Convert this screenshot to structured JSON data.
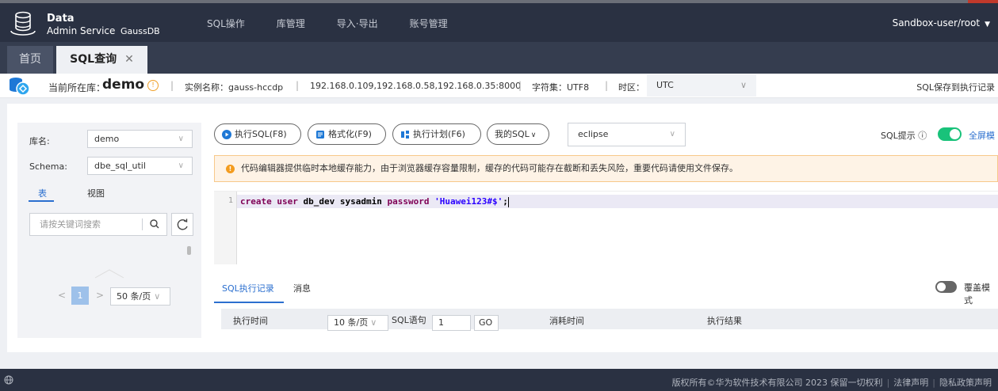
{
  "header": {
    "logo_title": "Data",
    "logo_sub": "Admin Service",
    "logo_product": "GaussDB",
    "nav": [
      "SQL操作",
      "库管理",
      "导入·导出",
      "账号管理"
    ],
    "user": "Sandbox-user/root"
  },
  "tabs": {
    "home": "首页",
    "sql": "SQL查询",
    "close": "✕"
  },
  "info": {
    "current_db_label": "当前所在库：",
    "current_db": "demo",
    "instance": "实例名称：gauss-hccdp",
    "hosts": "192.168.0.109,192.168.0.58,192.168.0.35:8000",
    "charset": "字符集：UTF8",
    "timezone_label": "时区：",
    "timezone": "UTC",
    "save_record": "SQL保存到执行记录"
  },
  "left": {
    "db_label": "库名:",
    "db_value": "demo",
    "schema_label": "Schema:",
    "schema_value": "dbe_sql_util",
    "tab_table": "表",
    "tab_view": "视图",
    "search_placeholder": "请按关键词搜索",
    "page": "1",
    "page_size": "50 条/页"
  },
  "toolbar": {
    "execute": "执行SQL(F8)",
    "format": "格式化(F9)",
    "plan": "执行计划(F6)",
    "mysql": "我的SQL",
    "theme": "eclipse",
    "sql_hint": "SQL提示",
    "fullscreen": "全屏模"
  },
  "warning": "代码编辑器提供临时本地缓存能力，由于浏览器缓存容量限制，缓存的代码可能存在截断和丢失风险，重要代码请使用文件保存。",
  "editor": {
    "line_number": "1",
    "tokens": {
      "create": "create",
      "user": "user",
      "name": "db_dev",
      "sysadmin": "sysadmin",
      "password": "password",
      "pwd": "'Huawei123#$'",
      "end": ";"
    }
  },
  "results": {
    "tab_history": "SQL执行记录",
    "tab_messages": "消息",
    "cover_mode": "覆盖模式",
    "col_time": "执行时间",
    "page_size": "10 条/页",
    "col_sql": "SQL语句",
    "page_input": "1",
    "go": "GO",
    "col_elapsed": "消耗时间",
    "col_result": "执行结果"
  },
  "footer": {
    "copyright": "版权所有©华为软件技术有限公司 2023 保留一切权利",
    "legal": "法律声明",
    "privacy": "隐私政策声明"
  },
  "colors": {
    "topbar": "#2a3142",
    "accent": "#2b6fcf",
    "toggle_on": "#19c27a",
    "warning": "#f39c1f"
  }
}
